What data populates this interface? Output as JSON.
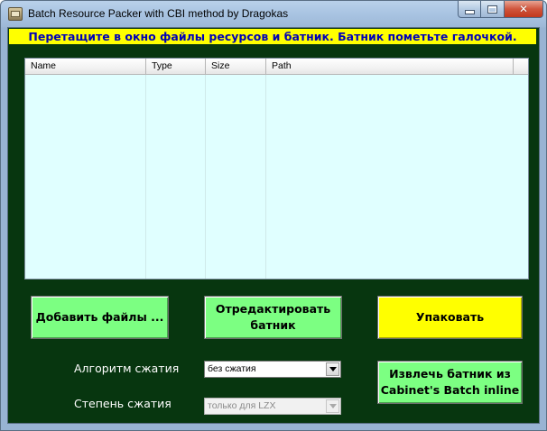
{
  "window": {
    "title": "Batch Resource Packer with CBI method by Dragokas",
    "controls": {
      "minimize_icon": "minimize-icon",
      "maximize_icon": "maximize-icon",
      "close_icon": "close-icon",
      "close_glyph": "✕"
    }
  },
  "banner": {
    "text": "Перетащите в окно файлы ресурсов и батник. Батник пометьте галочкой."
  },
  "file_list": {
    "columns": [
      "Name",
      "Type",
      "Size",
      "Path"
    ],
    "rows": []
  },
  "buttons": {
    "add_files": "Добавить файлы ...",
    "edit_batch": "Отредактировать батник",
    "pack": "Упаковать",
    "extract_batch": "Извлечь батник из Cabinet's Batch inline"
  },
  "compression": {
    "algorithm_label": "Алгоритм сжатия",
    "algorithm_value": "без сжатия",
    "level_label": "Степень сжатия",
    "level_value": "только для LZX"
  },
  "colors": {
    "client_background": "#07360f",
    "banner_background": "#ffff00",
    "banner_text": "#0000b8",
    "list_background": "#e0ffff",
    "green_button": "#7cff82",
    "pack_button": "#ffff00"
  }
}
